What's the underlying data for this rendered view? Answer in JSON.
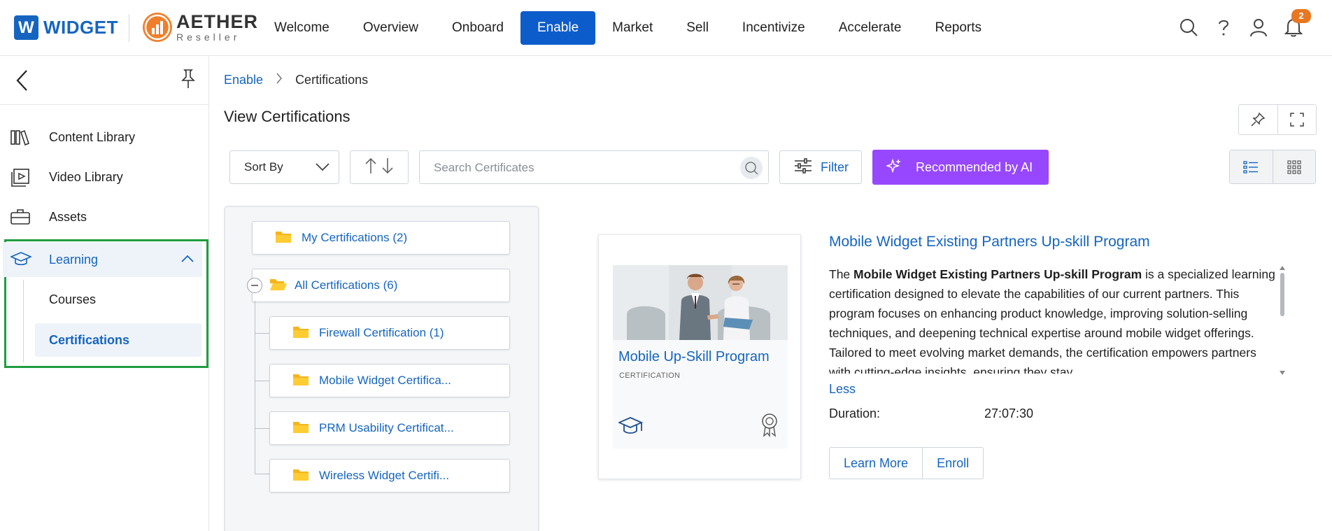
{
  "header": {
    "logo_widget": "WIDGET",
    "logo_widget_letter": "W",
    "logo_aether": "AETHER",
    "logo_aether_sub": "Reseller",
    "nav": [
      "Welcome",
      "Overview",
      "Onboard",
      "Enable",
      "Market",
      "Sell",
      "Incentivize",
      "Accelerate",
      "Reports"
    ],
    "active_nav": "Enable",
    "notification_count": "2",
    "icons": [
      "search-icon",
      "help-icon",
      "user-icon",
      "bell-icon"
    ]
  },
  "sidebar": {
    "items": [
      {
        "label": "Content Library",
        "icon": "books-icon"
      },
      {
        "label": "Video Library",
        "icon": "video-icon"
      },
      {
        "label": "Assets",
        "icon": "briefcase-icon"
      },
      {
        "label": "Learning",
        "icon": "graduation-cap-icon"
      }
    ],
    "sub_items": [
      "Courses",
      "Certifications"
    ],
    "active_sub": "Certifications",
    "highlight_color": "#1f9d3f"
  },
  "breadcrumb": {
    "parent": "Enable",
    "current": "Certifications"
  },
  "page": {
    "title": "View Certifications"
  },
  "toolbar": {
    "sort_label": "Sort By",
    "search_placeholder": "Search Certificates",
    "filter_label": "Filter",
    "ai_label": "Recommended by AI",
    "ai_color": "#9747ff"
  },
  "tree": {
    "my_certifications": "My Certifications (2)",
    "all_certifications": "All Certifications (6)",
    "children": [
      "Firewall Certification (1)",
      "Mobile Widget Certifica...",
      "PRM Usability Certificat...",
      "Wireless Widget Certifi..."
    ]
  },
  "card": {
    "title": "Mobile Up-Skill Program",
    "subtitle": "CERTIFICATION"
  },
  "detail": {
    "title": "Mobile Widget Existing Partners Up-skill Program",
    "desc_intro": "The ",
    "desc_bold": "Mobile Widget Existing Partners Up-skill Program",
    "desc_rest": " is a specialized learning certification designed to elevate the capabilities of our current partners. This program focuses on enhancing product knowledge, improving solution-selling techniques, and deepening technical expertise around mobile widget offerings. Tailored to meet evolving market demands, the certification empowers partners with cutting-edge insights, ensuring they stay",
    "less_label": "Less",
    "duration_label": "Duration:",
    "duration_value": "27:07:30",
    "learn_more_label": "Learn More",
    "enroll_label": "Enroll"
  }
}
